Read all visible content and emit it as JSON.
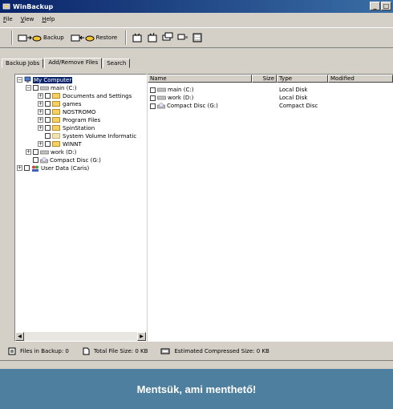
{
  "window": {
    "title": "WinBackup",
    "controls": [
      "_",
      "□"
    ]
  },
  "menu": [
    {
      "label": "File",
      "hotkey": "F"
    },
    {
      "label": "View",
      "hotkey": "V"
    },
    {
      "label": "Help",
      "hotkey": "H"
    }
  ],
  "toolbar": {
    "backup_label": "Backup",
    "restore_label": "Restore"
  },
  "tabs": [
    "Backup Jobs",
    "Add/Remove Files",
    "Search"
  ],
  "tree": [
    {
      "label": "My Computer",
      "selected": true
    },
    {
      "label": "main (C:)"
    },
    {
      "label": "Documents and Settings"
    },
    {
      "label": "games"
    },
    {
      "label": "NOSTROMO"
    },
    {
      "label": "Program Files"
    },
    {
      "label": "SpinStation"
    },
    {
      "label": "System Volume Informatic"
    },
    {
      "label": "WINNT"
    },
    {
      "label": "work (D:)"
    },
    {
      "label": "Compact Disc (G:)"
    },
    {
      "label": "User Data (Caris)"
    }
  ],
  "list": {
    "columns": [
      "Name",
      "Size",
      "Type",
      "Modified"
    ],
    "rows": [
      {
        "name": "main (C:)",
        "size": "",
        "type": "Local Disk",
        "modified": ""
      },
      {
        "name": "work (D:)",
        "size": "",
        "type": "Local Disk",
        "modified": ""
      },
      {
        "name": "Compact Disc (G:)",
        "size": "",
        "type": "Compact Disc",
        "modified": ""
      }
    ]
  },
  "status": {
    "files": "Files in Backup:  0",
    "total": "Total File Size:  0 KB",
    "estimated": "Estimated Compressed Size:  0 KB"
  },
  "caption": "Mentsük, ami menthető!",
  "colors": {
    "title_start": "#0a246a",
    "title_end": "#3a6ea5",
    "caption_bg": "#4e7f9e",
    "face": "#d4d0c8"
  }
}
